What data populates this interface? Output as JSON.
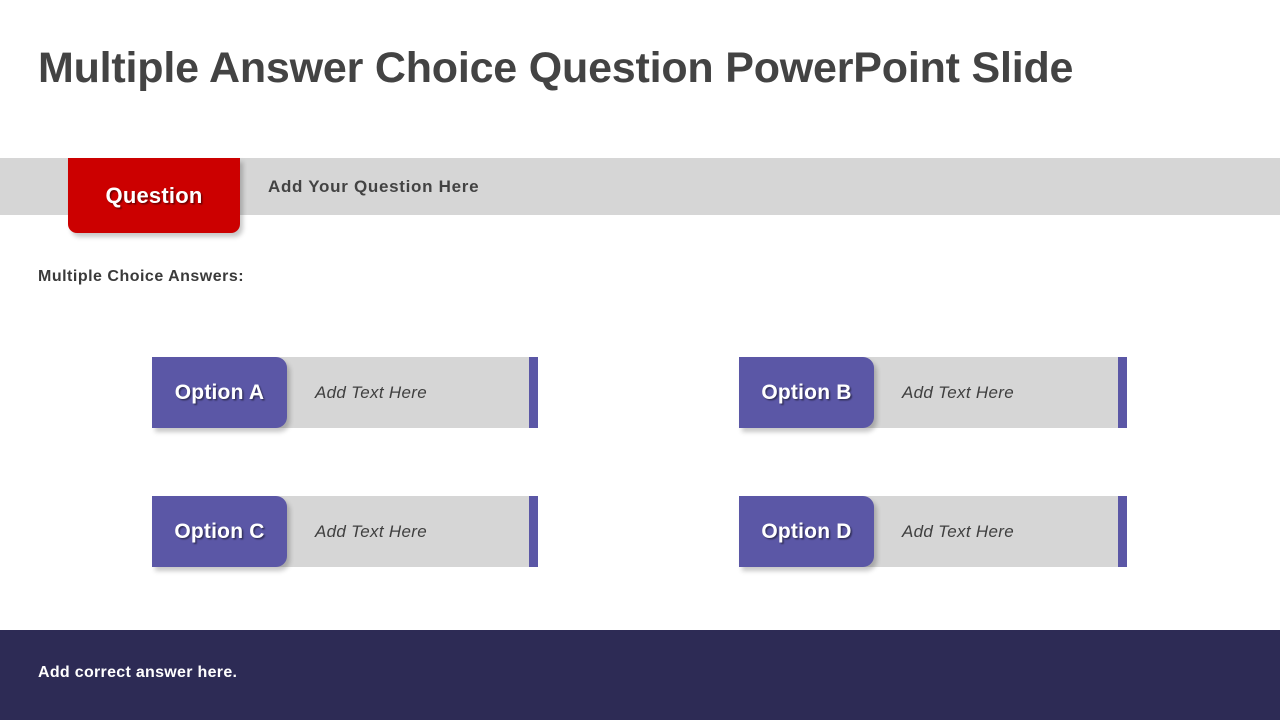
{
  "slide": {
    "title": "Multiple Answer Choice Question PowerPoint Slide",
    "answers_label": "Multiple Choice Answers:"
  },
  "question": {
    "tab_label": "Question",
    "placeholder": "Add Your Question Here"
  },
  "options": [
    {
      "tag": "Option A",
      "placeholder": "Add Text Here"
    },
    {
      "tag": "Option B",
      "placeholder": "Add Text Here"
    },
    {
      "tag": "Option C",
      "placeholder": "Add Text Here"
    },
    {
      "tag": "Option D",
      "placeholder": "Add Text Here"
    }
  ],
  "footer": {
    "text": "Add correct answer here."
  },
  "colors": {
    "title_text": "#434343",
    "question_tab": "#cc0000",
    "band_gray": "#d6d6d6",
    "option_purple": "#5b57a6",
    "footer_navy": "#2d2b55",
    "white": "#ffffff"
  }
}
